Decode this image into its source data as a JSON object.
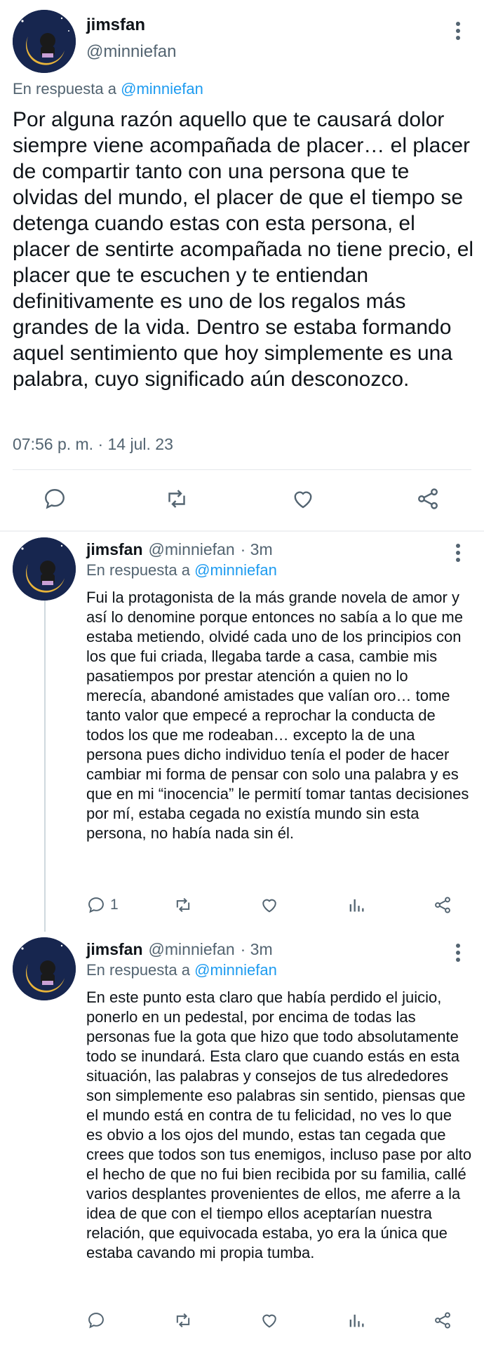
{
  "main_tweet": {
    "author_name": "jimsfan",
    "author_handle": "@minniefan",
    "reply_prefix": "En respuesta a",
    "reply_to": "@minniefan",
    "text": "Por alguna razón aquello que te causará dolor siempre viene acompañada de placer… el placer de compartir tanto con una persona que te olvidas del mundo, el placer de que el tiempo se detenga cuando estas con esta persona, el placer de sentirte acompañada no tiene precio, el placer que te escuchen y te entiendan definitivamente es uno de los regalos más grandes de la vida. Dentro se estaba formando aquel sentimiento que hoy simplemente es una palabra, cuyo significado aún desconozco.",
    "timestamp": "07:56 p. m. · 14 jul. 23",
    "icons": [
      "reply-icon",
      "retweet-icon",
      "like-icon",
      "share-icon",
      "more-icon"
    ]
  },
  "replies": [
    {
      "author_name": "jimsfan",
      "author_handle": "@minniefan",
      "time": "· 3m",
      "reply_prefix": "En respuesta a",
      "reply_to": "@minniefan",
      "text": "Fui la protagonista de la más grande novela de amor y así lo denomine porque entonces no sabía a lo que me estaba metiendo, olvidé cada uno de los principios con los que fui criada, llegaba tarde a casa, cambie mis pasatiempos por prestar atención a quien no lo merecía, abandoné amistades que valían oro… tome tanto valor que empecé a reprochar la conducta de todos los que me rodeaban… excepto la de una persona pues dicho individuo tenía el poder de hacer cambiar mi forma de pensar con solo una palabra y es que en mi “inocencia” le permití tomar tantas decisiones por mí,  estaba cegada no existía mundo sin esta persona, no había nada sin él.",
      "reply_count": "1"
    },
    {
      "author_name": "jimsfan",
      "author_handle": "@minniefan",
      "time": "· 3m",
      "reply_prefix": "En respuesta a",
      "reply_to": "@minniefan",
      "text": "En este punto esta claro que había perdido el juicio, ponerlo en un pedestal, por encima de todas las personas fue la gota que hizo que todo absolutamente todo se inundará. Esta claro que cuando estás en esta situación, las palabras y consejos de tus alrededores son simplemente eso palabras sin sentido, piensas que el mundo está en contra de tu felicidad, no ves lo que es obvio a los ojos del mundo, estas tan cegada que crees que todos son tus enemigos, incluso pase por alto el hecho de que no fui bien recibida por su familia, callé varios desplantes provenientes de ellos, me aferre a la idea de que con el tiempo ellos aceptarían nuestra relación, que equivocada estaba, yo era la única que estaba cavando mi propia tumba.",
      "reply_count": ""
    }
  ],
  "colors": {
    "text": "#0f1419",
    "secondary": "#536471",
    "link": "#1d9bf0",
    "avatar_bg": "#17264f",
    "moon": "#e8b43a"
  }
}
